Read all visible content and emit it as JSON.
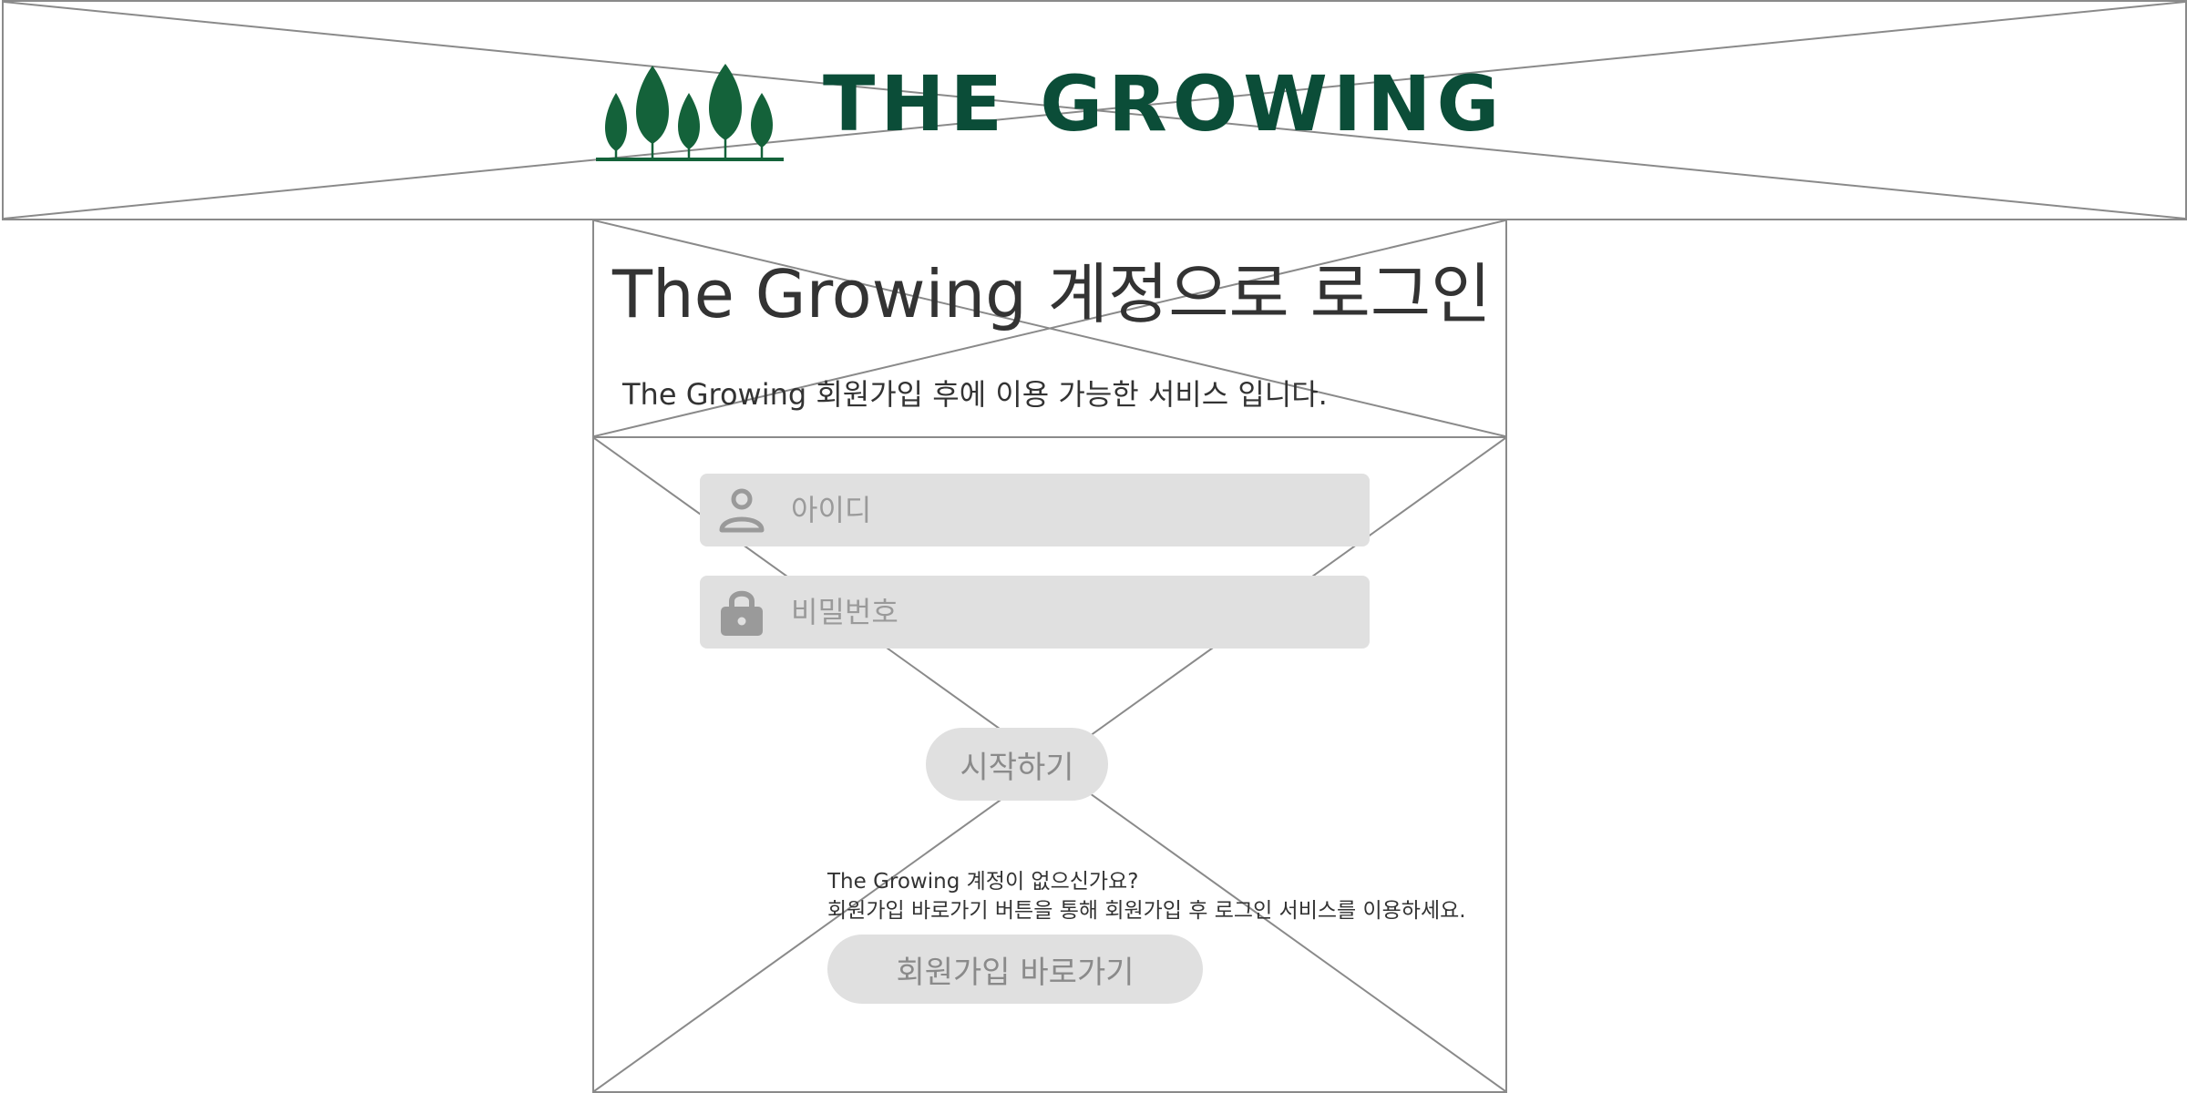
{
  "brand": {
    "name": "THE GROWING",
    "color": "#0b4d38",
    "logo_icon": "five-trees-icon"
  },
  "login": {
    "title": "The Growing 계정으로 로그인",
    "subtitle": "The Growing 회원가입 후에 이용 가능한 서비스 입니다.",
    "id_field": {
      "placeholder": "아이디",
      "value": "",
      "icon": "user-icon"
    },
    "password_field": {
      "placeholder": "비밀번호",
      "value": "",
      "icon": "lock-icon"
    },
    "start_button": "시작하기"
  },
  "signup": {
    "question": "The Growing 계정이 없으신가요?",
    "instruction": "회원가입 바로가기 버튼을 통해 회원가입 후 로그인 서비스를 이용하세요.",
    "button": "회원가입 바로가기"
  },
  "colors": {
    "field_bg": "#e0e0e0",
    "placeholder_text": "#9a9a9a",
    "wireframe_line": "#8a8a8a"
  }
}
